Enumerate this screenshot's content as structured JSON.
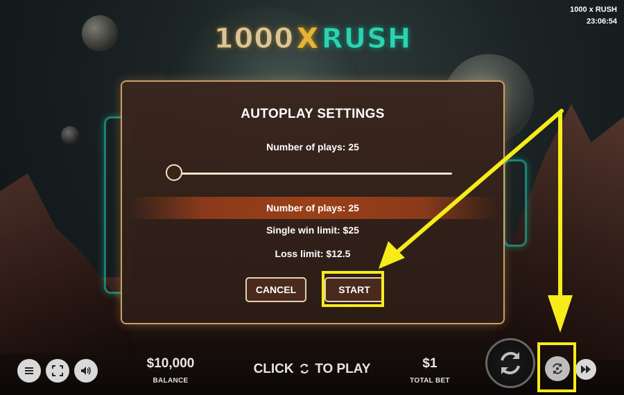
{
  "game": {
    "logo_num": "1000",
    "logo_x": "X",
    "logo_rush": "RUSH",
    "name": "1000 x RUSH",
    "clock": "23:06:54"
  },
  "modal": {
    "title": "AUTOPLAY SETTINGS",
    "plays_label": "Number of plays: 25",
    "slider_value": 25,
    "summary": {
      "plays": "Number of plays: 25",
      "win_limit": "Single win limit: $25",
      "loss_limit": "Loss limit: $12.5"
    },
    "cancel_label": "CANCEL",
    "start_label": "START"
  },
  "bottom": {
    "balance_value": "$10,000",
    "balance_label": "BALANCE",
    "click_prefix": "CLICK",
    "click_suffix": "TO PLAY",
    "total_bet_value": "$1",
    "total_bet_label": "TOTAL BET"
  },
  "icons": [
    "menu-icon",
    "fullscreen-icon",
    "sound-icon",
    "spin-icon",
    "autoplay-icon",
    "fast-forward-icon"
  ],
  "colors": {
    "highlight": "#f6ec1a",
    "accent_teal": "#1fd3b3",
    "modal_border": "#c9a06a",
    "summary_band": "#9a4018"
  }
}
